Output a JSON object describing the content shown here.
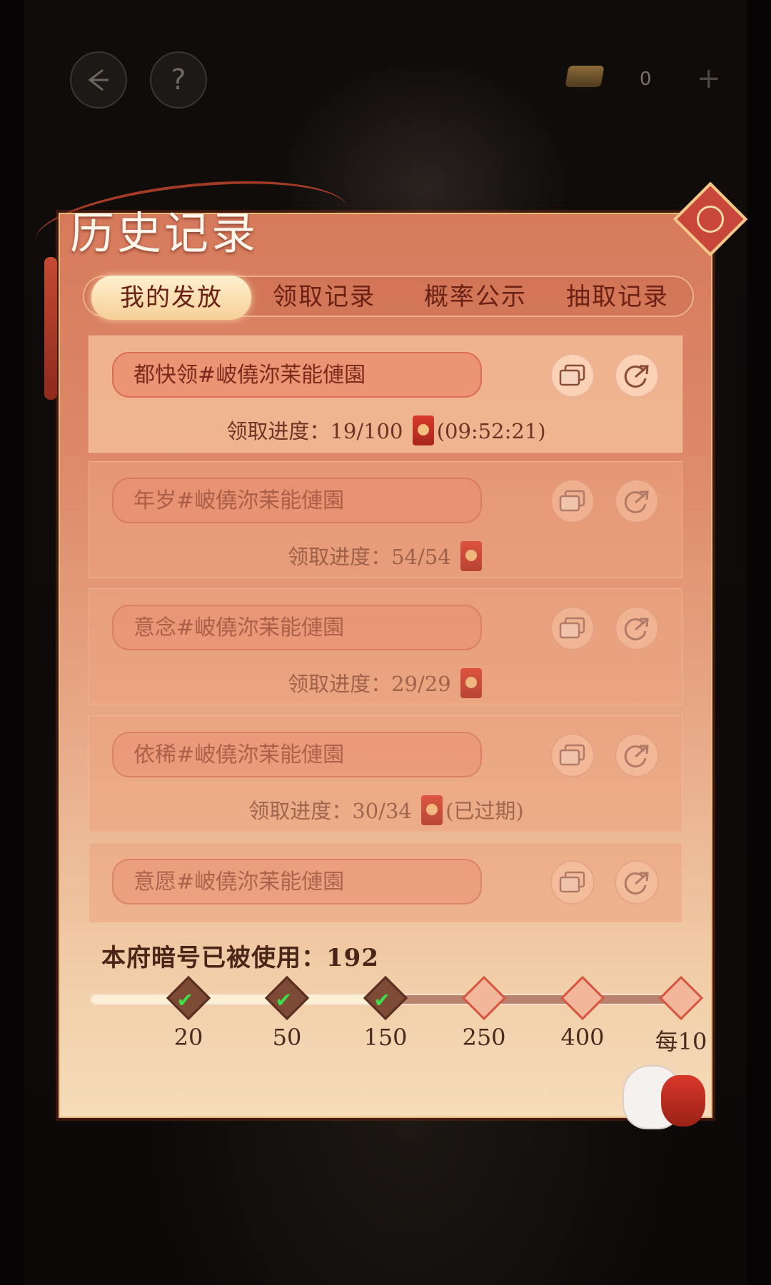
{
  "header": {
    "coin_count": "0",
    "help_label": "?",
    "plus_label": "+"
  },
  "panel": {
    "title": "历史记录"
  },
  "tabs": [
    "我的发放",
    "领取记录",
    "概率公示",
    "抽取记录"
  ],
  "records": [
    {
      "name": "都快领#岥僥沵苿能僆園",
      "progress_label": "领取进度：",
      "progress": "19/100",
      "suffix": "(09:52:21)"
    },
    {
      "name": "年岁#岥僥沵苿能僆園",
      "progress_label": "领取进度：",
      "progress": "54/54",
      "suffix": ""
    },
    {
      "name": "意念#岥僥沵苿能僆園",
      "progress_label": "领取进度：",
      "progress": "29/29",
      "suffix": ""
    },
    {
      "name": "依稀#岥僥沵苿能僆園",
      "progress_label": "领取进度：",
      "progress": "30/34",
      "suffix": "(已过期)"
    },
    {
      "name": "意愿#岥僥沵苿能僆園",
      "progress_label": "",
      "progress": "",
      "suffix": ""
    }
  ],
  "usage": {
    "label": "本府暗号已被使用：",
    "count": "192",
    "progress_fraction": 0.5,
    "milestones": [
      {
        "label": "20",
        "reached": true
      },
      {
        "label": "50",
        "reached": true
      },
      {
        "label": "150",
        "reached": true
      },
      {
        "label": "250",
        "reached": false
      },
      {
        "label": "400",
        "reached": false
      },
      {
        "label": "每10",
        "reached": false
      }
    ]
  },
  "icons": {
    "back": "back-arrow-icon",
    "copy": "copy-icon",
    "share": "share-icon",
    "red_packet": "red-packet-icon",
    "check": "check-icon"
  },
  "colors": {
    "panel_top": "#d77a5c",
    "panel_bottom": "#f6dcb9",
    "accent": "#c9473a",
    "text_dark": "#6a2014",
    "check_green": "#3ee04a"
  }
}
